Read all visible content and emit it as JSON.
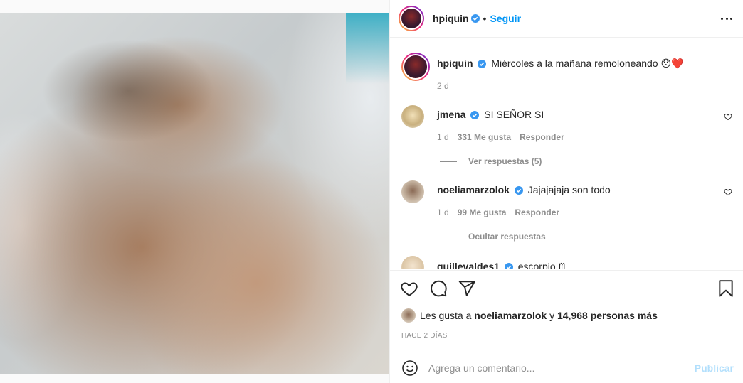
{
  "post": {
    "username": "hpiquin",
    "follow_label": "Seguir",
    "separator": "•",
    "more_icon": "more-horizontal-icon"
  },
  "caption": {
    "username": "hpiquin",
    "text": "Miércoles a la mañana remoloneando",
    "emojis": "😯❤️",
    "time": "2 d"
  },
  "comments": [
    {
      "username": "jmena",
      "text": "SI SEÑOR SI",
      "time": "1 d",
      "likes": "331 Me gusta",
      "reply_label": "Responder",
      "replies_toggle": "Ver respuestas (5)"
    },
    {
      "username": "noeliamarzolok",
      "text": "Jajajajaja son todo",
      "time": "1 d",
      "likes": "99 Me gusta",
      "reply_label": "Responder",
      "replies_toggle": "Ocultar respuestas"
    },
    {
      "username": "guillevaldes1",
      "text": "escorpio ♏"
    }
  ],
  "likes_line": {
    "prefix": "Les gusta a",
    "liker": "noeliamarzolok",
    "joiner": "y",
    "count": "14,968 personas más"
  },
  "date": "HACE 2 DÍAS",
  "composer": {
    "placeholder": "Agrega un comentario...",
    "publish_label": "Publicar"
  },
  "colors": {
    "accent": "#0095f6",
    "verified": "#3897f0",
    "muted": "#8e8e8e",
    "publish_disabled": "#b2dffc"
  }
}
